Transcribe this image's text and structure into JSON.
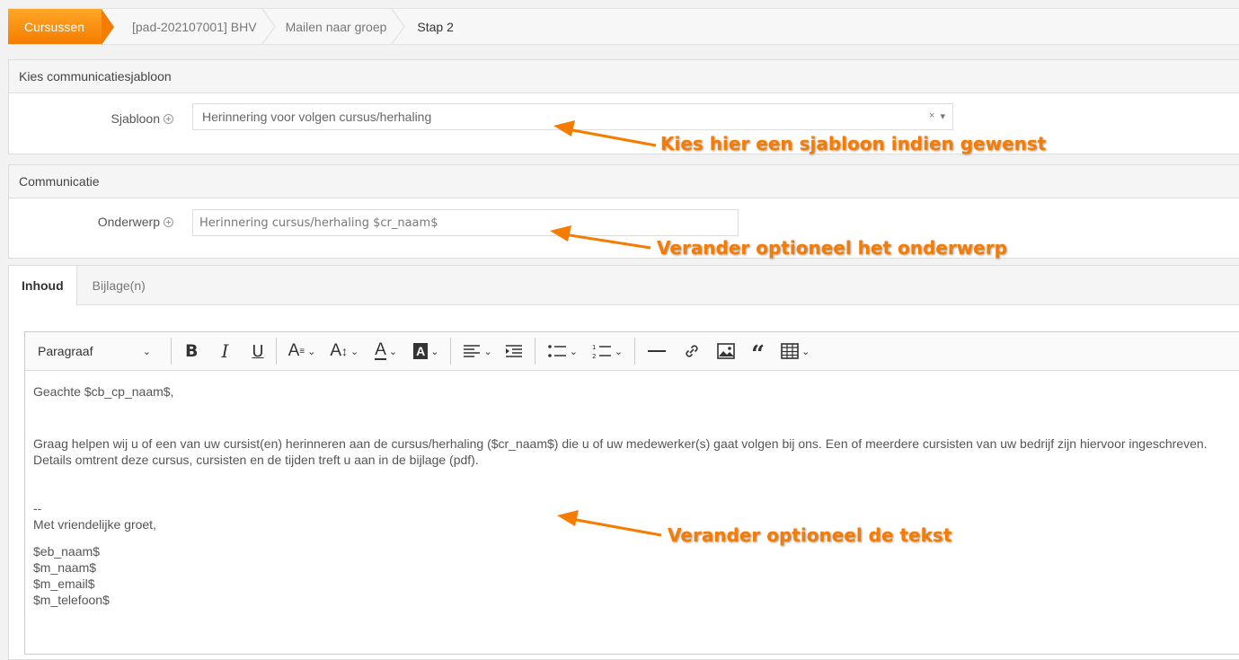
{
  "breadcrumb": {
    "items": [
      "Cursussen",
      "[pad-202107001] BHV",
      "Mailen naar groep",
      "Stap 2"
    ]
  },
  "template_panel": {
    "title": "Kies communicatiesjabloon",
    "label": "Sjabloon",
    "value": "Herinnering voor volgen cursus/herhaling",
    "clear": "×",
    "dropdown": "▾"
  },
  "communication_panel": {
    "title": "Communicatie",
    "label": "Onderwerp",
    "value": "Herinnering cursus/herhaling $cr_naam$"
  },
  "tabs": {
    "items": [
      "Inhoud",
      "Bijlage(n)"
    ]
  },
  "editor": {
    "paragraph_select": "Paragraaf",
    "body": {
      "greeting": "Geachte $cb_cp_naam$,",
      "line1": "Graag helpen wij u of een van uw cursist(en) herinneren aan de cursus/herhaling ($cr_naam$) die u of uw medewerker(s) gaat volgen bij ons. Een of meerdere cursisten van uw bedrijf zijn hiervoor ingeschreven.",
      "line2": "Details omtrent deze cursus, cursisten en de tijden treft u aan in de bijlage (pdf).",
      "dash": "--",
      "closing": "Met vriendelijke groet,",
      "sig1": "$eb_naam$",
      "sig2": "$m_naam$",
      "sig3": "$m_email$",
      "sig4": "$m_telefoon$"
    }
  },
  "annotations": {
    "a1": "Kies hier een sjabloon indien gewenst",
    "a2": "Verander optioneel het onderwerp",
    "a3": "Verander optioneel de tekst"
  },
  "colors": {
    "accent": "#f57c00"
  }
}
